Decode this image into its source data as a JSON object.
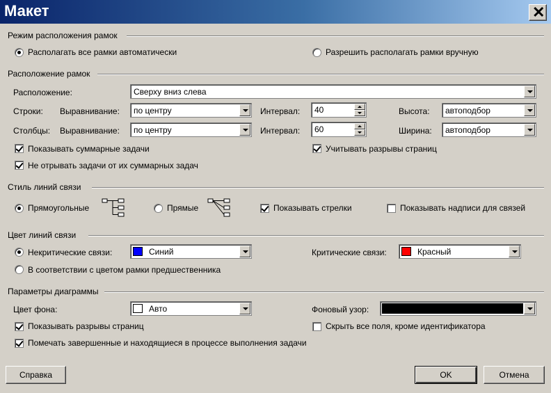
{
  "window": {
    "title": "Макет",
    "close_label": "✕"
  },
  "frame_mode": {
    "section_title": "Режим расположения рамок",
    "auto_label": "Располагать все рамки автоматически",
    "manual_label": "Разрешить располагать рамки вручную",
    "selected": "auto"
  },
  "frame_layout": {
    "section_title": "Расположение рамок",
    "layout_label": "Расположение:",
    "layout_value": "Сверху вниз слева",
    "rows": {
      "label": "Строки:",
      "align_label": "Выравнивание:",
      "align_value": "по центру",
      "interval_label": "Интервал:",
      "interval_value": "40",
      "size_label": "Высота:",
      "size_value": "автоподбор"
    },
    "cols": {
      "label": "Столбцы:",
      "align_label": "Выравнивание:",
      "align_value": "по центру",
      "interval_label": "Интервал:",
      "interval_value": "60",
      "size_label": "Ширина:",
      "size_value": "автоподбор"
    },
    "show_summary_label": "Показывать суммарные задачи",
    "show_summary_checked": true,
    "keep_with_summary_label": "Не отрывать задачи от их суммарных задач",
    "keep_with_summary_checked": true,
    "page_breaks_label": "Учитывать разрывы страниц",
    "page_breaks_checked": true
  },
  "link_style": {
    "section_title": "Стиль линий связи",
    "rectilinear_label": "Прямоугольные",
    "straight_label": "Прямые",
    "selected": "rectilinear",
    "show_arrows_label": "Показывать стрелки",
    "show_arrows_checked": true,
    "show_labels_label": "Показывать надписи для связей",
    "show_labels_checked": false,
    "rectilinear_icon": "tree-rectilinear-icon",
    "straight_icon": "tree-straight-icon"
  },
  "link_color": {
    "section_title": "Цвет линий связи",
    "noncritical_label": "Некритические связи:",
    "noncritical_value": "Синий",
    "noncritical_color": "#0000ff",
    "critical_label": "Критические связи:",
    "critical_value": "Красный",
    "critical_color": "#ff0000",
    "match_predecessor_label": "В соответствии с цветом рамки предшественника",
    "selected": "noncritical"
  },
  "diagram": {
    "section_title": "Параметры диаграммы",
    "bg_color_label": "Цвет фона:",
    "bg_color_value": "Авто",
    "bg_color": "#ffffff",
    "bg_pattern_label": "Фоновый узор:",
    "bg_pattern_color": "#000000",
    "show_page_breaks_label": "Показывать разрывы страниц",
    "show_page_breaks_checked": true,
    "hide_fields_label": "Скрыть все поля, кроме идентификатора",
    "hide_fields_checked": false,
    "mark_progress_label": "Помечать завершенные и находящиеся в процессе выполнения задачи",
    "mark_progress_checked": true
  },
  "buttons": {
    "help": "Справка",
    "ok": "OK",
    "cancel": "Отмена"
  }
}
